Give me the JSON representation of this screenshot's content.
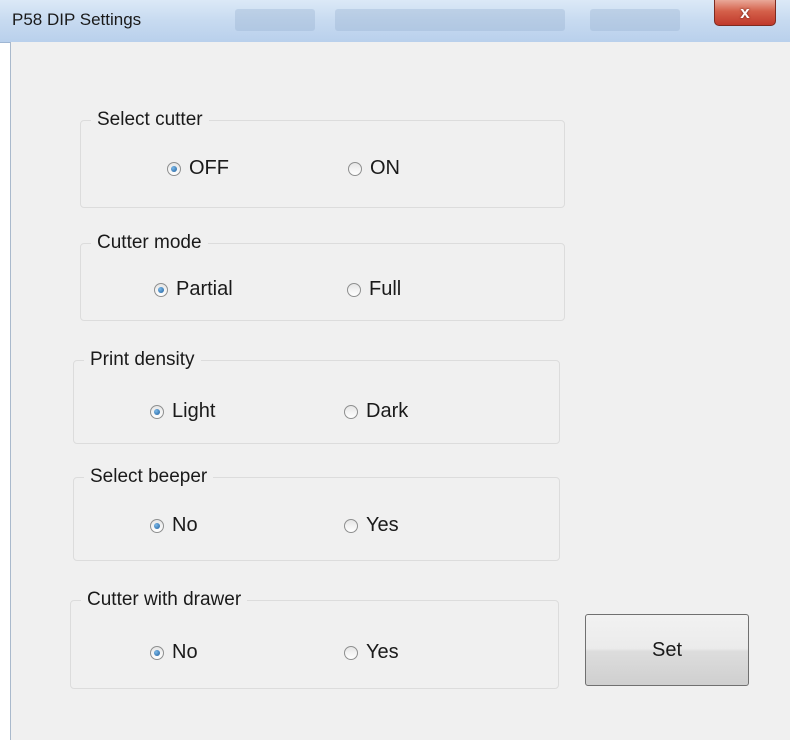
{
  "window": {
    "title": "P58 DIP Settings",
    "close_glyph": "x"
  },
  "groups": [
    {
      "label": "Select cutter",
      "options": [
        {
          "label": "OFF",
          "checked": true
        },
        {
          "label": "ON",
          "checked": false
        }
      ]
    },
    {
      "label": "Cutter mode",
      "options": [
        {
          "label": "Partial",
          "checked": true
        },
        {
          "label": "Full",
          "checked": false
        }
      ]
    },
    {
      "label": "Print density",
      "options": [
        {
          "label": "Light",
          "checked": true
        },
        {
          "label": "Dark",
          "checked": false
        }
      ]
    },
    {
      "label": "Select beeper",
      "options": [
        {
          "label": "No",
          "checked": true
        },
        {
          "label": "Yes",
          "checked": false
        }
      ]
    },
    {
      "label": "Cutter with drawer",
      "options": [
        {
          "label": "No",
          "checked": true
        },
        {
          "label": "Yes",
          "checked": false
        }
      ]
    }
  ],
  "set_button": {
    "label": "Set"
  }
}
